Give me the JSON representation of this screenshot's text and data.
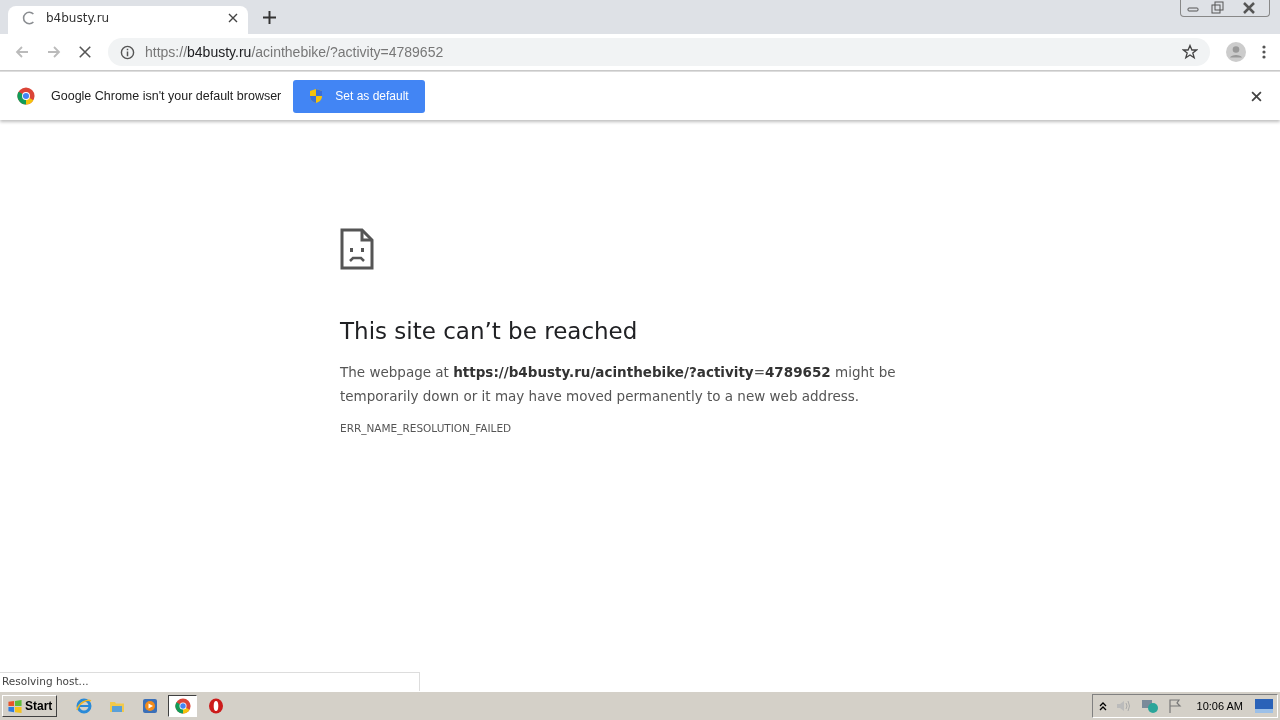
{
  "tab": {
    "title": "b4busty.ru",
    "loading": true
  },
  "address_bar": {
    "scheme": "https://",
    "host": "b4busty.ru",
    "path": "/acinthebike/?activity=4789652"
  },
  "infobar": {
    "message": "Google Chrome isn't your default browser",
    "button": "Set as default"
  },
  "error": {
    "title": "This site can’t be reached",
    "message": "The webpage at **https://b4busty.ru/acinthebike/?activity**=**4789652** might be temporarily down or it may have moved permanently to a new web address.",
    "code": "ERR_NAME_RESOLUTION_FAILED"
  },
  "status_bubble": "Resolving host...",
  "taskbar": {
    "start": "Start",
    "apps": [
      {
        "kind": "ie",
        "selected": false
      },
      {
        "kind": "explorer",
        "selected": false
      },
      {
        "kind": "media",
        "selected": false
      },
      {
        "kind": "chrome",
        "selected": true
      },
      {
        "kind": "opera",
        "selected": false
      }
    ],
    "clock": "10:06 AM"
  }
}
